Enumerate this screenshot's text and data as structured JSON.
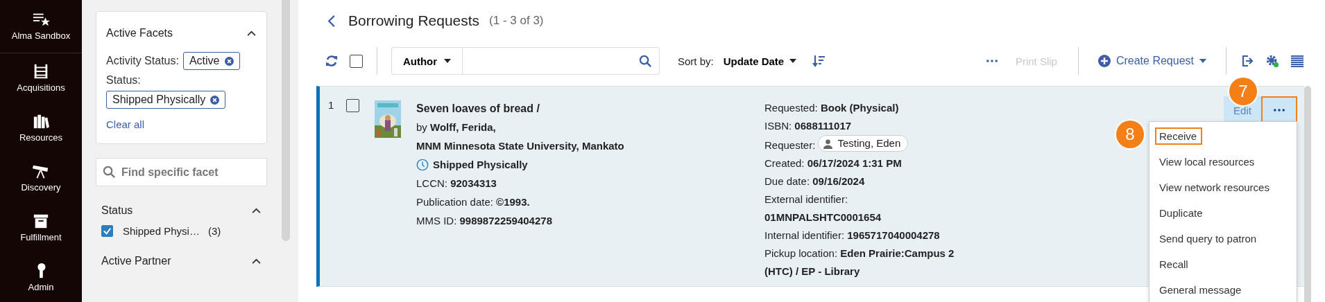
{
  "nav": [
    {
      "label": "Alma Sandbox",
      "kind": "star-list"
    },
    {
      "label": "Acquisitions",
      "kind": "abacus"
    },
    {
      "label": "Resources",
      "kind": "books"
    },
    {
      "label": "Discovery",
      "kind": "telescope"
    },
    {
      "label": "Fulfillment",
      "kind": "archive"
    },
    {
      "label": "Admin",
      "kind": "key"
    }
  ],
  "active_facets": {
    "title": "Active Facets",
    "expanded": true,
    "groups": [
      {
        "label": "Activity Status:",
        "chips": [
          "Active"
        ]
      },
      {
        "label": "Status:",
        "chips": [
          "Shipped Physically"
        ]
      }
    ],
    "clear": "Clear all"
  },
  "facet_search": {
    "placeholder": "Find specific facet"
  },
  "facet_sections": [
    {
      "title": "Status",
      "expanded": true,
      "options": [
        {
          "label": "Shipped Physi…",
          "count": "(3)",
          "checked": true
        }
      ]
    },
    {
      "title": "Active Partner",
      "expanded": true
    }
  ],
  "header": {
    "title": "Borrowing Requests",
    "count": "(1 - 3 of 3)"
  },
  "toolbar": {
    "select_all": false,
    "search_by": "Author",
    "sort_label": "Sort by:",
    "sort_value": "Update Date",
    "print_slip": {
      "label": "Print Slip",
      "disabled": true
    },
    "create": "Create Request"
  },
  "rows": [
    {
      "number": "1",
      "checked": false,
      "selected": true,
      "title": "Seven loaves of bread /",
      "by": "by",
      "author": "Wolff, Ferida,",
      "library": "MNM Minnesota State University, Mankato",
      "status": "Shipped Physically",
      "fields": [
        {
          "label": "LCCN:",
          "value": "92034313"
        },
        {
          "label": "Publication date:",
          "value": "©1993."
        },
        {
          "label": "MMS ID:",
          "value": "9989872259404278"
        }
      ],
      "details": [
        {
          "label": "Requested:",
          "value": "Book (Physical)",
          "kind": "text"
        },
        {
          "label": "ISBN:",
          "value": "0688111017",
          "kind": "text"
        },
        {
          "label": "Requester:",
          "value": "Testing, Eden",
          "kind": "person"
        },
        {
          "label": "Created:",
          "value": "06/17/2024 1:31 PM",
          "kind": "text"
        },
        {
          "label": "Due date:",
          "value": "09/16/2024",
          "kind": "text"
        },
        {
          "label": "External identifier:",
          "value": "01MNPALSHTC0001654",
          "kind": "block"
        },
        {
          "label": "Internal identifier:",
          "value": "1965717040004278",
          "kind": "text"
        },
        {
          "label": "Pickup location:",
          "value": "Eden Prairie:Campus 2 (HTC) / EP - Library",
          "kind": "text"
        }
      ],
      "edit": "Edit",
      "more_callout": "7",
      "more_highlighted": true,
      "menu": [
        {
          "label": "Receive",
          "highlighted": true,
          "callout": "8"
        },
        {
          "label": "View local resources",
          "highlighted": false
        },
        {
          "label": "View network resources",
          "highlighted": false
        },
        {
          "label": "Duplicate",
          "highlighted": false
        },
        {
          "label": "Send query to patron",
          "highlighted": false
        },
        {
          "label": "Recall",
          "highlighted": false
        },
        {
          "label": "General message",
          "highlighted": false
        }
      ]
    }
  ]
}
